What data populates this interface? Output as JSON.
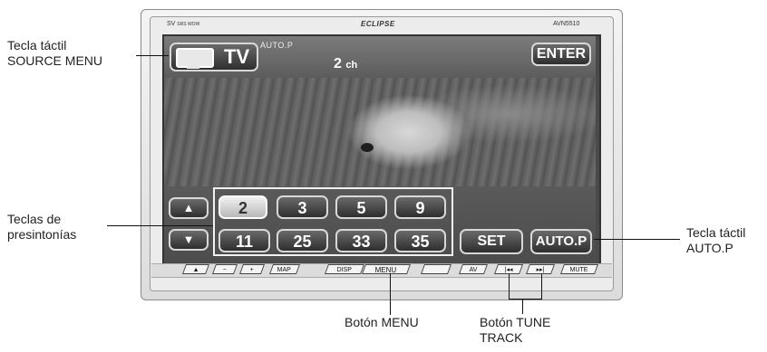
{
  "callouts": {
    "source_menu": "Tecla táctil\nSOURCE MENU",
    "presets": "Teclas de\npresintonías",
    "autop": "Tecla táctil\nAUTO.P",
    "menu_button": "Botón MENU",
    "tune_track": "Botón TUNE\nTRACK"
  },
  "unit": {
    "brand_small": "SV",
    "brand_small_sub": "SRS WOW",
    "logo": "ECLIPSE",
    "model": "AVN5510"
  },
  "screen": {
    "source_label": "TV",
    "autop_indicator": "AUTO.P",
    "channel_number": "2",
    "channel_unit": "ch",
    "enter": "ENTER",
    "up_arrow": "▲",
    "down_arrow": "▼",
    "presets_row1": [
      "2",
      "3",
      "5",
      "9"
    ],
    "presets_row2": [
      "11",
      "25",
      "33",
      "35"
    ],
    "selected_preset": "2",
    "set": "SET",
    "autop": "AUTO.P"
  },
  "hardware": {
    "eject": "▲",
    "minus": "−",
    "plus": "+",
    "map": "MAP",
    "disp": "DISP",
    "menu": "MENU",
    "av": "AV",
    "prev": "|◂◂",
    "next": "▸▸|",
    "mute": "MUTE"
  }
}
